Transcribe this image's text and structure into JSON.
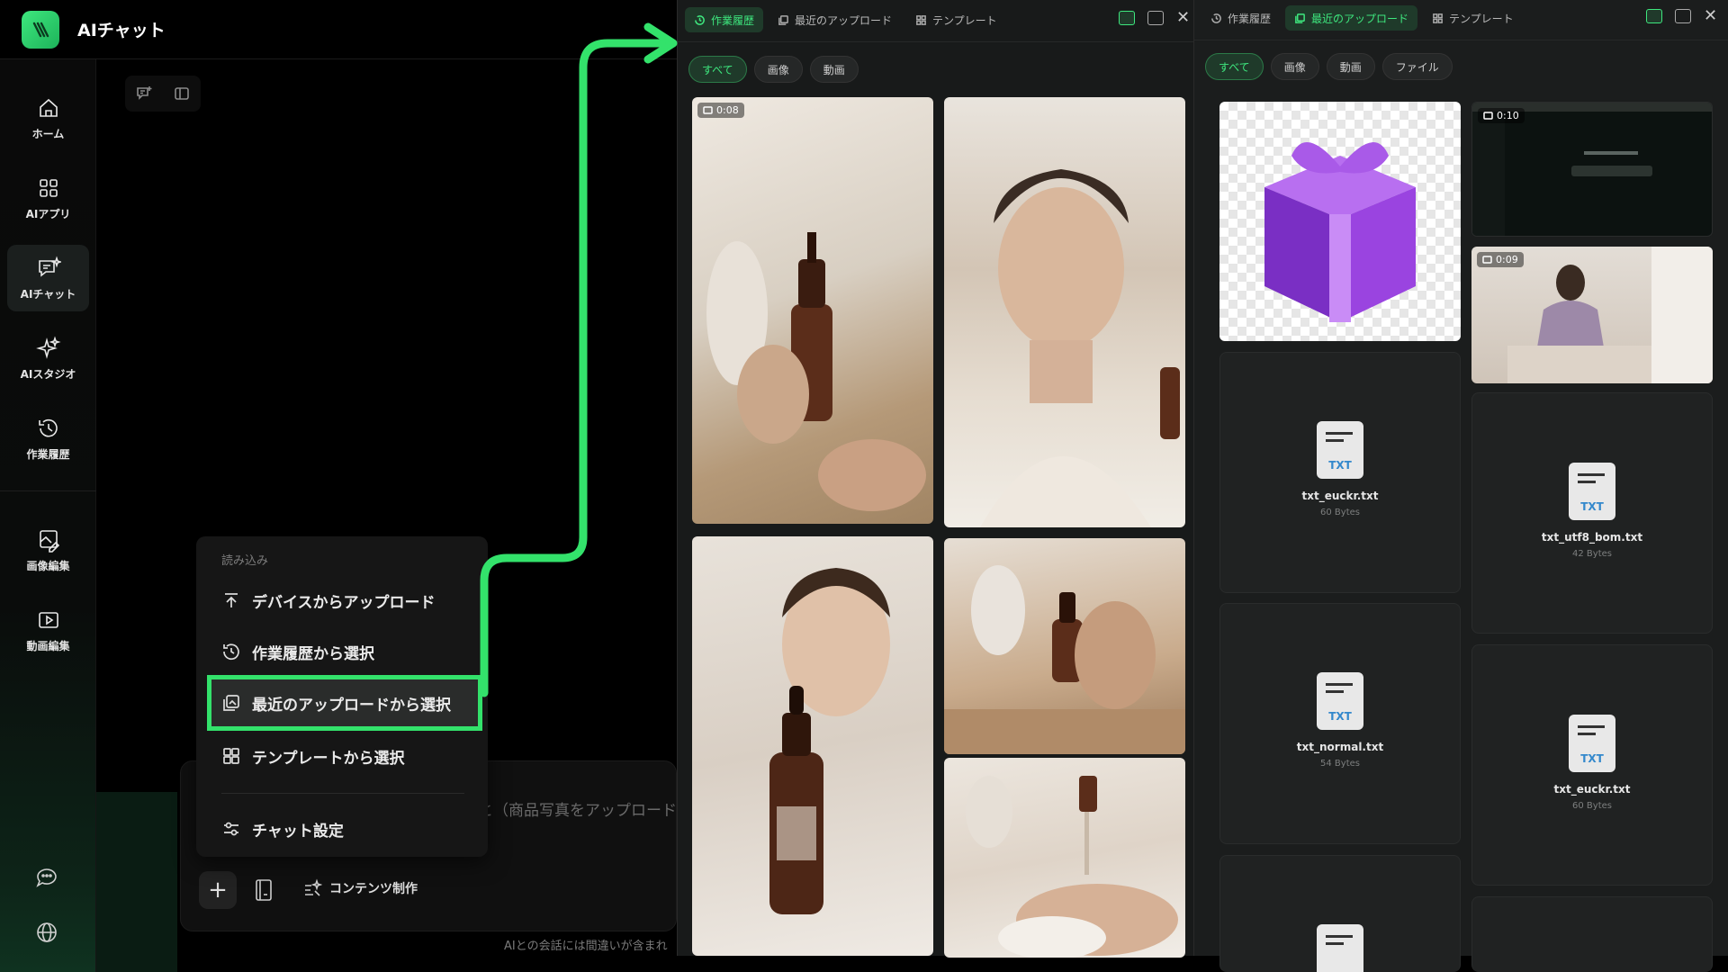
{
  "app": {
    "title": "AIチャット"
  },
  "nav": {
    "items": [
      {
        "label": "ホーム"
      },
      {
        "label": "AIアプリ"
      },
      {
        "label": "AIチャット"
      },
      {
        "label": "AIスタジオ"
      },
      {
        "label": "作業履歴"
      },
      {
        "label": "画像編集"
      },
      {
        "label": "動画編集"
      }
    ]
  },
  "composer": {
    "placeholder_fragment": "と（商品写真をアップロード",
    "content_label": "コンテンツ制作",
    "disclaimer": "AIとの会話には間違いが含まれ"
  },
  "menu": {
    "header": "読み込み",
    "items": [
      {
        "label": "デバイスからアップロード"
      },
      {
        "label": "作業履歴から選択"
      },
      {
        "label": "最近のアップロードから選択"
      },
      {
        "label": "テンプレートから選択"
      },
      {
        "label": "チャット設定"
      }
    ]
  },
  "panel_history": {
    "tabs": [
      "作業履歴",
      "最近のアップロード",
      "テンプレート"
    ],
    "filters": [
      "すべて",
      "画像",
      "動画"
    ],
    "tiles": [
      {
        "duration": "0:08"
      }
    ]
  },
  "panel_uploads": {
    "tabs": [
      "作業履歴",
      "最近のアップロード",
      "テンプレート"
    ],
    "filters": [
      "すべて",
      "画像",
      "動画",
      "ファイル"
    ],
    "videos": [
      {
        "duration": "0:10"
      },
      {
        "duration": "0:09"
      }
    ],
    "files": [
      {
        "badge": "TXT",
        "name": "txt_euckr.txt",
        "size": "60 Bytes"
      },
      {
        "badge": "TXT",
        "name": "txt_utf8_bom.txt",
        "size": "42 Bytes"
      },
      {
        "badge": "TXT",
        "name": "txt_normal.txt",
        "size": "54 Bytes"
      },
      {
        "badge": "TXT",
        "name": "txt_euckr.txt",
        "size": "60 Bytes"
      }
    ]
  },
  "colors": {
    "accent": "#33e26b",
    "active_tab_bg": "#1f3a2a"
  }
}
